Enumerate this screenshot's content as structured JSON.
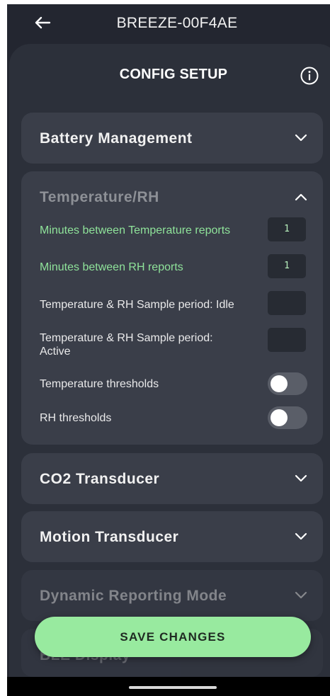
{
  "header": {
    "back_icon": "arrow-left-icon",
    "device_name": "BREEZE-00F4AE"
  },
  "sheet": {
    "title": "CONFIG SETUP",
    "info_icon": "info-icon"
  },
  "sections": {
    "battery": {
      "title": "Battery Management",
      "expanded": false
    },
    "temperature": {
      "title": "Temperature/RH",
      "expanded": true,
      "rows": {
        "temp_minutes": {
          "label": "Minutes between Temperature reports",
          "value": "1"
        },
        "rh_minutes": {
          "label": "Minutes between RH reports",
          "value": "1"
        },
        "sample_idle": {
          "label": "Temperature & RH Sample period: Idle",
          "value": ""
        },
        "sample_active": {
          "label": "Temperature & RH Sample period: Active",
          "value": ""
        },
        "temp_thresholds": {
          "label": "Temperature thresholds",
          "enabled": false
        },
        "rh_thresholds": {
          "label": "RH thresholds",
          "enabled": false
        }
      }
    },
    "co2": {
      "title": "CO2 Transducer",
      "expanded": false
    },
    "motion": {
      "title": "Motion Transducer",
      "expanded": false
    },
    "dynamic": {
      "title": "Dynamic Reporting Mode",
      "expanded": false
    },
    "ble": {
      "title": "BLE Display",
      "expanded": false
    }
  },
  "actions": {
    "save_label": "SAVE CHANGES"
  },
  "colors": {
    "accent_green": "#98ea9f",
    "label_green": "#8fe39a",
    "background": "#232630",
    "card": "#3a3e49"
  }
}
